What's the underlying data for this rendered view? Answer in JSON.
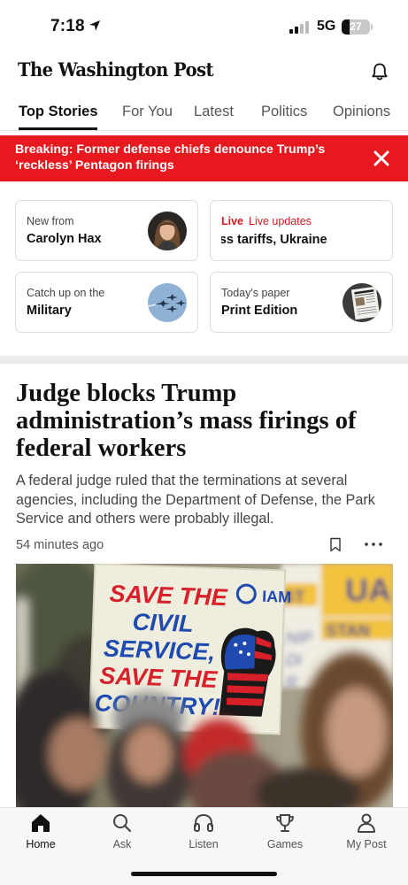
{
  "status_bar": {
    "time": "7:18",
    "network": "5G",
    "battery": "27"
  },
  "masthead": {
    "logo": "The Washington Post"
  },
  "tabs": [
    {
      "label": "Top Stories",
      "active": true
    },
    {
      "label": "For You"
    },
    {
      "label": "Latest"
    },
    {
      "label": "Politics"
    },
    {
      "label": "Opinions"
    }
  ],
  "breaking": {
    "text": "Breaking: Former defense chiefs denounce Trump’s ‘reckless’ Pentagon firings"
  },
  "cards": [
    {
      "kicker": "New from",
      "title": "Carolyn Hax"
    },
    {
      "badge": "Live",
      "kicker": "Live updates",
      "title": "uss tariffs, Ukraine"
    },
    {
      "kicker": "Catch up on the",
      "title": "Military"
    },
    {
      "kicker": "Today's paper",
      "title": "Print Edition"
    }
  ],
  "article": {
    "headline": "Judge blocks Trump administration’s mass firings of federal workers",
    "dek": "A federal judge ruled that the terminations at several agencies, including the Department of Defense, the Park Service and others were probably illegal.",
    "time": "54 minutes ago",
    "photo_sign": {
      "lines": [
        "SAVE THE",
        "CIVIL",
        "SERVICE,",
        "SAVE THE",
        "COUNTRY!"
      ],
      "logo": "IAM"
    }
  },
  "bottom_nav": [
    {
      "label": "Home",
      "icon": "home-icon",
      "active": true
    },
    {
      "label": "Ask",
      "icon": "search-icon"
    },
    {
      "label": "Listen",
      "icon": "headphones-icon"
    },
    {
      "label": "Games",
      "icon": "trophy-icon"
    },
    {
      "label": "My Post",
      "icon": "person-icon"
    }
  ],
  "colors": {
    "breaking": "#e7181e",
    "live": "#d71920",
    "sign_red": "#d8202a",
    "sign_blue": "#1f4bb0"
  }
}
